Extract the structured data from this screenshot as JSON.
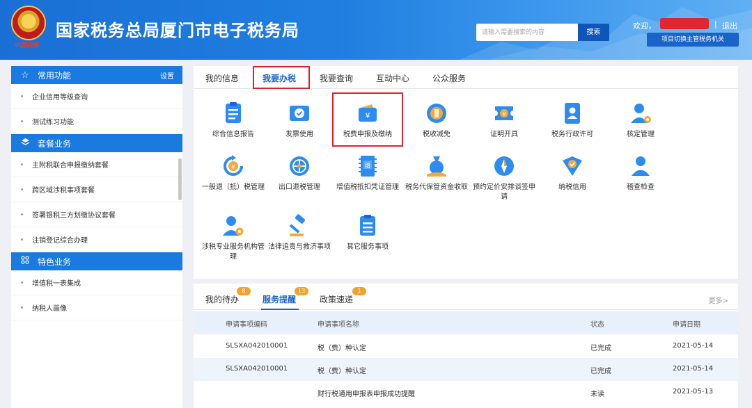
{
  "header": {
    "emblem_text": "中国税务",
    "title": "国家税务总局厦门市电子税务局",
    "search_placeholder": "请输入需要搜索的内容",
    "search_button": "搜索",
    "welcome": "欢迎，",
    "separator": "|",
    "logout": "退出",
    "switch_button": "项目切换主管税务机关"
  },
  "sidebar": {
    "sections": [
      {
        "title": "常用功能",
        "icon": "star-icon",
        "extra": "设置",
        "items": [
          "企业信用等级查询",
          "测试练习功能"
        ]
      },
      {
        "title": "套餐业务",
        "icon": "layers-icon",
        "extra": "",
        "items": [
          "主附税联合申报缴纳套餐",
          "跨区域涉税事项套餐",
          "签署银税三方划缴协议套餐",
          "注销登记综合办理"
        ]
      },
      {
        "title": "特色业务",
        "icon": "grid-icon",
        "extra": "",
        "items": [
          "增值税一表集成",
          "纳税人画像"
        ]
      }
    ]
  },
  "main_tabs": [
    "我的信息",
    "我要办税",
    "我要查询",
    "互动中心",
    "公众服务"
  ],
  "services": [
    {
      "label": "综合信息报告",
      "icon": "document-list-icon"
    },
    {
      "label": "发票使用",
      "icon": "invoice-check-icon"
    },
    {
      "label": "税费申报及缴纳",
      "icon": "wallet-yuan-icon"
    },
    {
      "label": "税收减免",
      "icon": "coin-stack-icon"
    },
    {
      "label": "证明开具",
      "icon": "ticket-yuan-icon"
    },
    {
      "label": "税务行政许可",
      "icon": "id-card-icon"
    },
    {
      "label": "核定管理",
      "icon": "user-gear-icon"
    },
    {
      "label": "一般退（抵）税管理",
      "icon": "refresh-yuan-icon"
    },
    {
      "label": "出口退税管理",
      "icon": "globe-icon"
    },
    {
      "label": "增值税抵扣凭证管理",
      "icon": "vat-ticket-icon"
    },
    {
      "label": "税务代保管资金收取",
      "icon": "money-bag-icon"
    },
    {
      "label": "预约定价安排谈签申请",
      "icon": "compass-icon"
    },
    {
      "label": "纳税信用",
      "icon": "shield-check-icon"
    },
    {
      "label": "稽查检查",
      "icon": "user-icon"
    },
    {
      "label": "涉税专业服务机构管理",
      "icon": "user-settings-icon"
    },
    {
      "label": "法律追责与救济事项",
      "icon": "gavel-icon"
    },
    {
      "label": "其它服务事项",
      "icon": "document-lines-icon"
    }
  ],
  "bottom_tabs": [
    {
      "label": "我的待办",
      "badge": "8"
    },
    {
      "label": "服务提醒",
      "badge": "13"
    },
    {
      "label": "政策速递",
      "badge": "1"
    }
  ],
  "more": "更多>",
  "table": {
    "headers": [
      "申请事项编码",
      "申请事项名称",
      "状态",
      "申请日期"
    ],
    "rows": [
      [
        "SLSXA042010001",
        "税（费）种认定",
        "已完成",
        "2021-05-14"
      ],
      [
        "SLSXA042010001",
        "税（费）种认定",
        "已完成",
        "2021-05-14"
      ],
      [
        "",
        "财行税通用申报表申报成功提醒",
        "未读",
        "2021-05-13"
      ]
    ]
  },
  "colors": {
    "brand": "#1a7ae0",
    "accent": "#1a63c8",
    "highlight": "#e0212d",
    "badge": "#f0a32f"
  }
}
